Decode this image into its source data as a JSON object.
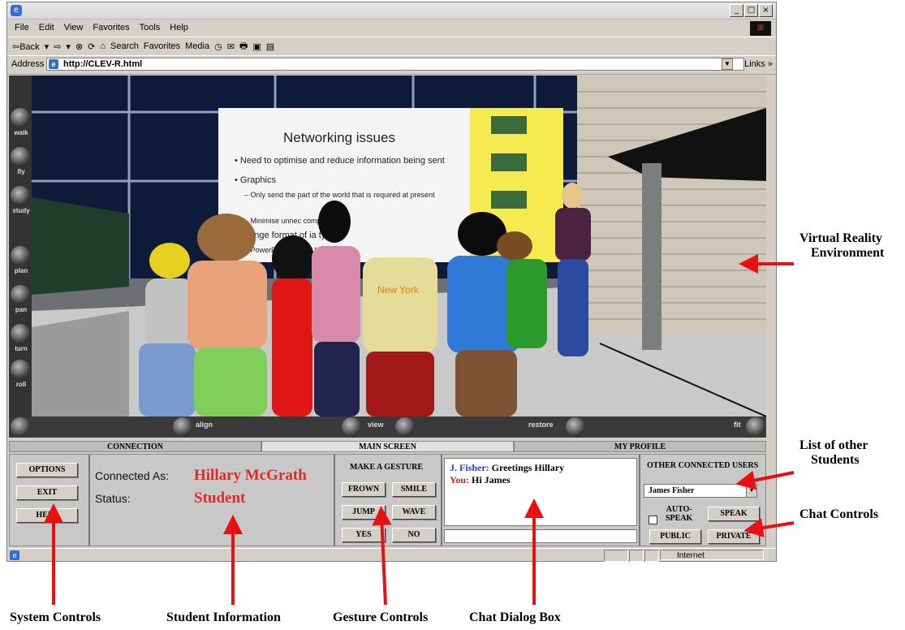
{
  "browser": {
    "menu": [
      "File",
      "Edit",
      "View",
      "Favorites",
      "Tools",
      "Help"
    ],
    "toolbar": [
      "⇦Back",
      "▾",
      "⇨",
      "▾",
      "⊗",
      "⟳",
      "⌂",
      "Search",
      "Favorites",
      "Media",
      "◷",
      "✉",
      "🖶",
      "▣",
      "▤"
    ],
    "address_label": "Address",
    "address_value": "http://CLEV-R.html",
    "links_label": "Links",
    "status_zone": "Internet"
  },
  "viewport": {
    "nav_left": [
      "walk",
      "fly",
      "study",
      "plan",
      "pan",
      "turn",
      "roll"
    ],
    "nav_bottom": [
      "align",
      "view",
      "restore",
      "fit"
    ],
    "slide": {
      "title": "Networking issues",
      "bullets": [
        "Need to optimise and reduce information being sent",
        "Graphics",
        "– Only send the part of the world that is required at present",
        "– Minimise unnec            compr         tion",
        "hange format of       ia typ",
        "e PowerPoint/Pic     ord            HTML"
      ]
    },
    "shirt_text": "New York"
  },
  "tabs": [
    "CONNECTION",
    "MAIN SCREEN",
    "MY PROFILE"
  ],
  "system": {
    "buttons": [
      "OPTIONS",
      "EXIT",
      "HELP"
    ]
  },
  "student": {
    "connected_label": "Connected As:",
    "status_label": "Status:",
    "name": "Hillary McGrath",
    "status": "Student"
  },
  "gestures": {
    "header": "MAKE A GESTURE",
    "buttons": [
      "FROWN",
      "SMILE",
      "JUMP",
      "WAVE",
      "YES",
      "NO"
    ]
  },
  "chat": {
    "messages": [
      {
        "speaker": "J. Fisher:",
        "text": " Greetings Hillary",
        "color": "#2540c0"
      },
      {
        "speaker": "You:",
        "text": " Hi James",
        "color": "#d02020"
      }
    ]
  },
  "users": {
    "header": "OTHER CONNECTED USERS",
    "selected": "James Fisher",
    "auto_speak_line1": "AUTO-",
    "auto_speak_line2": "SPEAK",
    "speak": "SPEAK",
    "public": "PUBLIC",
    "private": "PRIVATE"
  },
  "annotations": {
    "vr_line1": "Virtual Reality",
    "vr_line2": "Environment",
    "students_line1": "List of other",
    "students_line2": "Students",
    "chat_controls": "Chat Controls",
    "system_controls": "System Controls",
    "student_info": "Student Information",
    "gesture_controls": "Gesture Controls",
    "chat_dialog": "Chat Dialog Box"
  },
  "colors": {
    "annotation_arrow": "#e81010",
    "student_text": "#e02a2a"
  }
}
